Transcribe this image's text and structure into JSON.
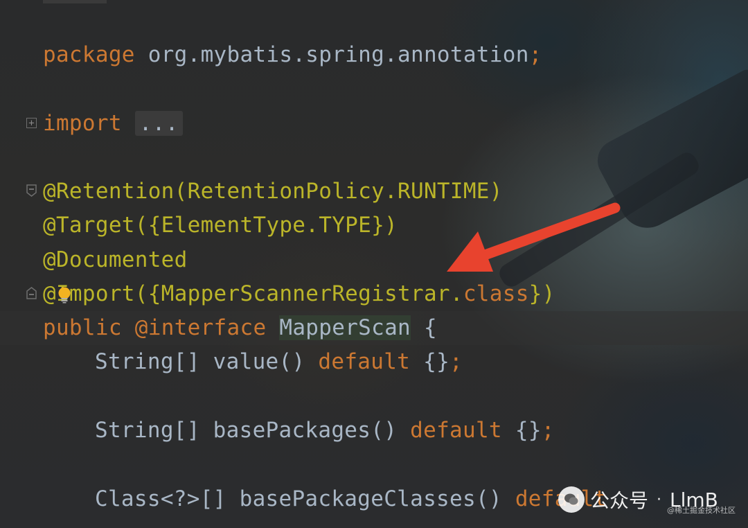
{
  "code": {
    "package_line": {
      "keyword": "package",
      "rest": " org.mybatis.spring.annotation",
      "semicolon": ";"
    },
    "import_line": {
      "keyword": "import",
      "folded": "..."
    },
    "ann_retention": "@Retention(RetentionPolicy.RUNTIME)",
    "ann_target": "@Target({ElementType.TYPE})",
    "ann_documented": "@Documented",
    "ann_import": {
      "prefix": "@Import({MapperScannerRegistrar.",
      "class_kw": "class",
      "suffix": "})"
    },
    "decl": {
      "public_kw": "public",
      "interface_kw": "@interface",
      "name": "MapperScan",
      "brace": " {"
    },
    "m1": {
      "type": "String[] value() ",
      "default_kw": "default",
      "tail": " {}",
      "semi": ";"
    },
    "m2": {
      "type": "String[] basePackages() ",
      "default_kw": "default",
      "tail": " {}",
      "semi": ";"
    },
    "m3": {
      "type": "Class<?>[] basePackageClasses() ",
      "default_kw": "default"
    }
  },
  "gutter_icons": [
    "expand-icon",
    "collapse-icon",
    "collapse-icon"
  ],
  "intention_icon": "lightbulb-icon",
  "annotation_arrow_color": "#e8432e",
  "watermark": {
    "label": "公众号",
    "separator": "·",
    "account": "LlmB"
  },
  "juejin": "@稀土掘金技术社区",
  "colors": {
    "keyword": "#cc7832",
    "annotation": "#bbb529",
    "text": "#a9b7c6",
    "background": "#2b2b2b"
  }
}
